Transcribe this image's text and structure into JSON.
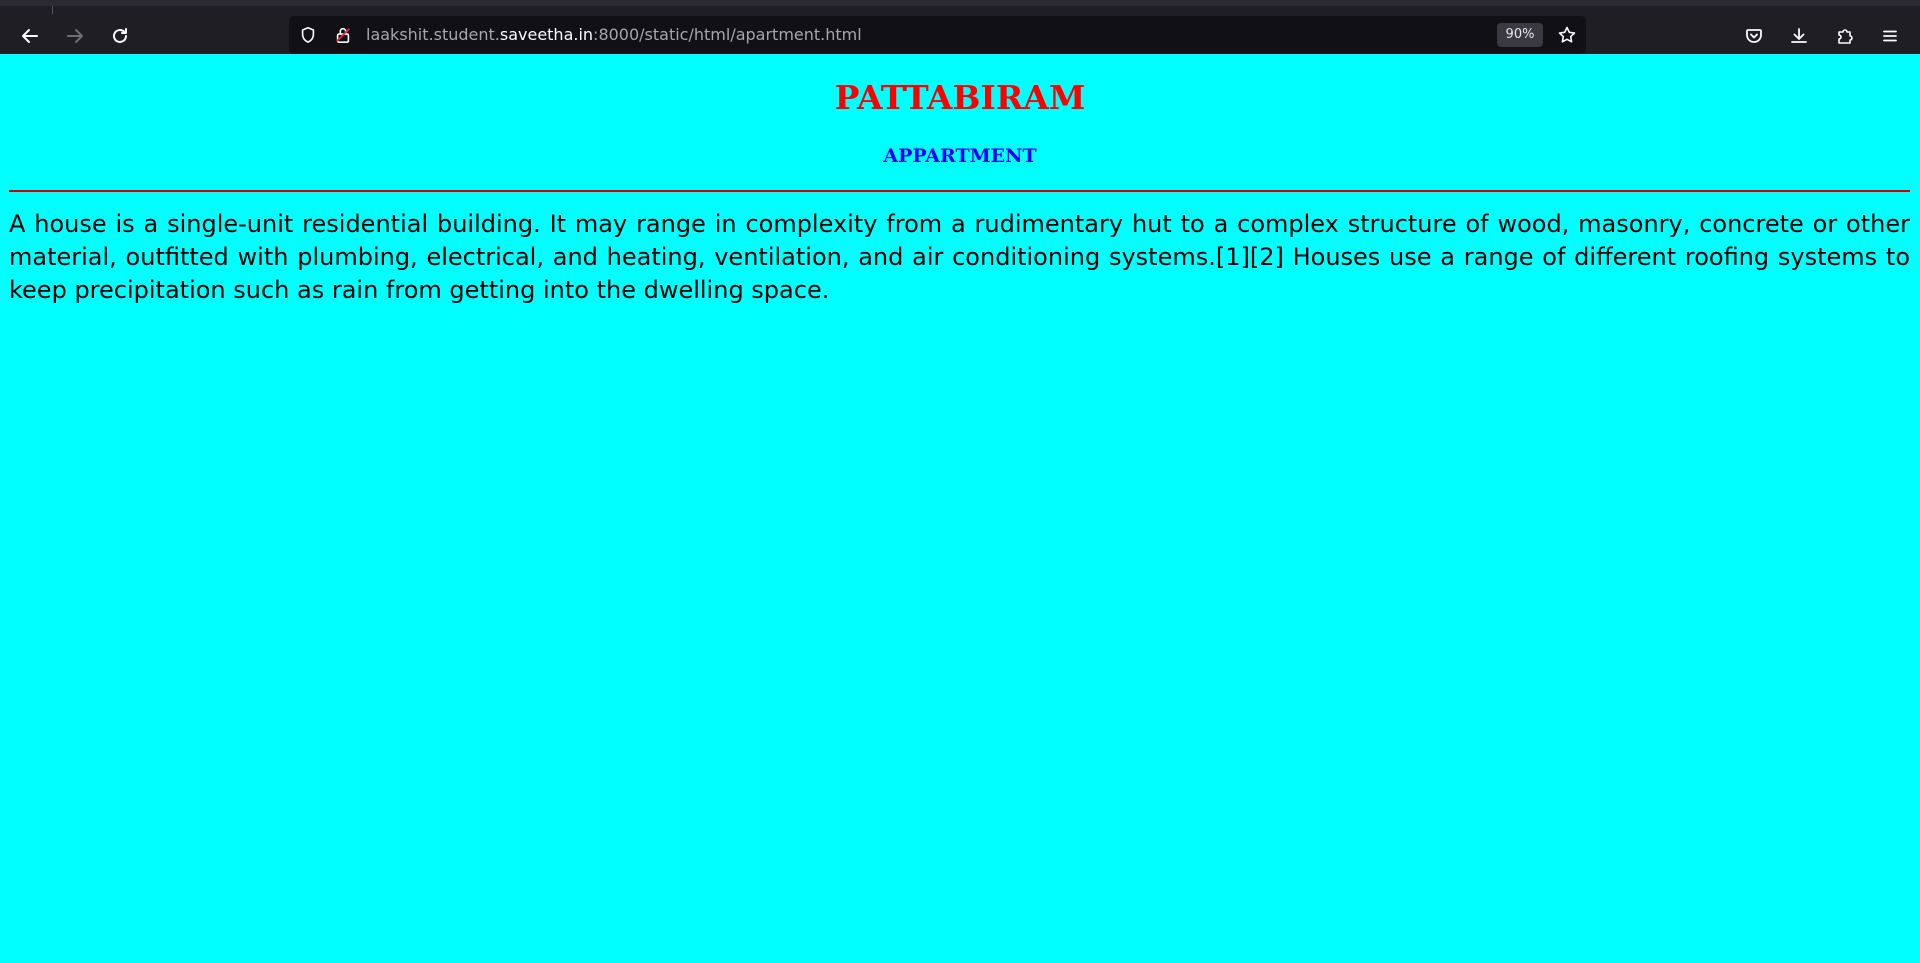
{
  "browser": {
    "url_prefix": "laakshit.student.",
    "url_host": "saveetha.in",
    "url_suffix": ":8000/static/html/apartment.html",
    "zoom": "90%",
    "icons": [
      "back-arrow-icon",
      "forward-arrow-icon",
      "reload-icon",
      "shield-icon",
      "insecure-lock-icon",
      "star-icon",
      "pocket-icon",
      "download-icon",
      "extensions-icon",
      "menu-icon"
    ]
  },
  "page": {
    "background": "#00ffff",
    "title": "PATTABIRAM",
    "title_color": "#ff0000",
    "subtitle": "APPARTMENT",
    "subtitle_color": "#0000ff",
    "divider_color": "#d40000",
    "paragraph": "A house is a single-unit residential building. It may range in complexity from a rudimentary hut to a complex structure of wood, masonry, concrete or other material, outfitted with plumbing, electrical, and heating, ventilation, and air conditioning systems.[1][2] Houses use a range of different roofing systems to keep precipitation such as rain from getting into the dwelling space."
  }
}
